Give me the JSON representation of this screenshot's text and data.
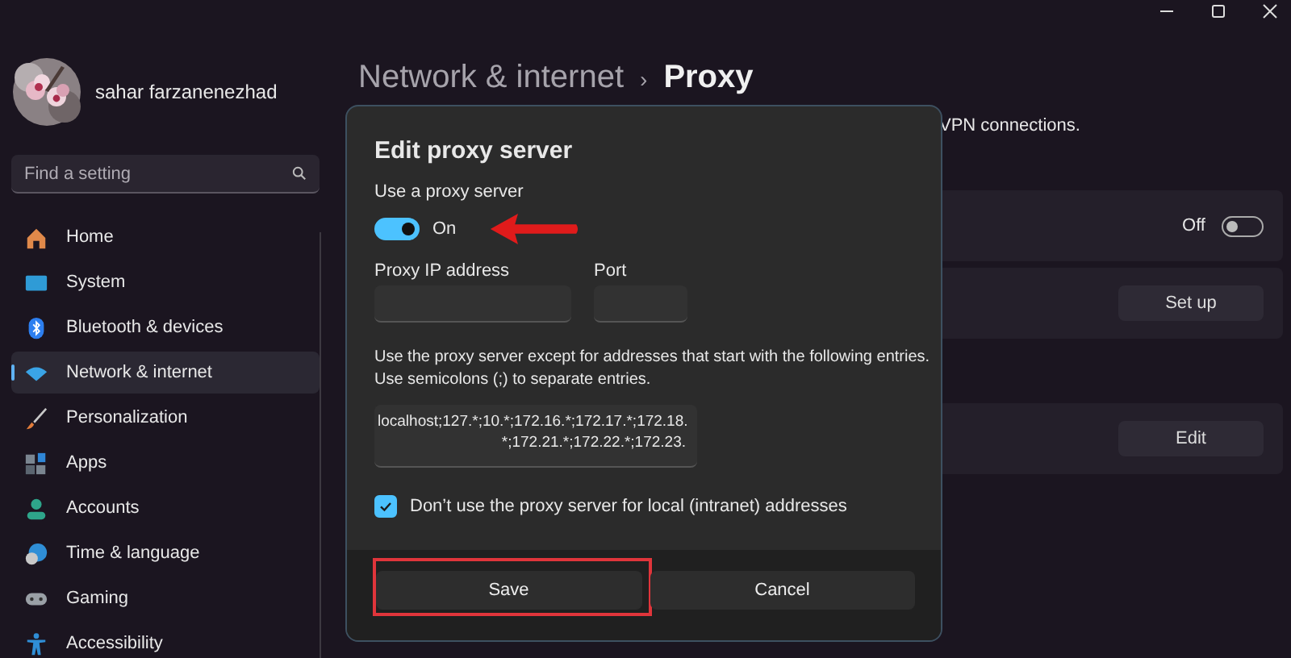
{
  "user": {
    "name": "sahar farzanenezhad"
  },
  "search": {
    "placeholder": "Find a setting"
  },
  "nav": [
    {
      "label": "Home",
      "selected": false
    },
    {
      "label": "System",
      "selected": false
    },
    {
      "label": "Bluetooth & devices",
      "selected": false
    },
    {
      "label": "Network & internet",
      "selected": true
    },
    {
      "label": "Personalization",
      "selected": false
    },
    {
      "label": "Apps",
      "selected": false
    },
    {
      "label": "Accounts",
      "selected": false
    },
    {
      "label": "Time & language",
      "selected": false
    },
    {
      "label": "Gaming",
      "selected": false
    },
    {
      "label": "Accessibility",
      "selected": false
    }
  ],
  "breadcrumb": {
    "parent": "Network & internet",
    "separator": "›",
    "current": "Proxy"
  },
  "description": "VPN connections.",
  "sections": [
    [
      {
        "kind": "toggle",
        "state_label": "Off",
        "on": false
      },
      {
        "kind": "button",
        "button": "Set up"
      }
    ],
    [
      {
        "kind": "button",
        "button": "Edit"
      }
    ]
  ],
  "dialog": {
    "title": "Edit proxy server",
    "proxy_toggle": {
      "label": "Use a proxy server",
      "state_label": "On",
      "on": true,
      "annotated": true
    },
    "ip_field": {
      "label": "Proxy IP address"
    },
    "port_field": {
      "label": "Port"
    },
    "exceptions": {
      "description": "Use the proxy server except for addresses that start with the following entries. Use semicolons (;) to separate entries.",
      "value_lines": [
        "localhost;127.*;10.*;172.16.*;172.17.*;172.18.",
        "*;172.21.*;172.22.*;172.23."
      ]
    },
    "local_checkbox": {
      "label": "Don’t use the proxy server for local (intranet) addresses",
      "checked": true
    },
    "buttons": [
      {
        "label": "Save",
        "highlighted": true
      },
      {
        "label": "Cancel",
        "highlighted": false
      }
    ]
  }
}
